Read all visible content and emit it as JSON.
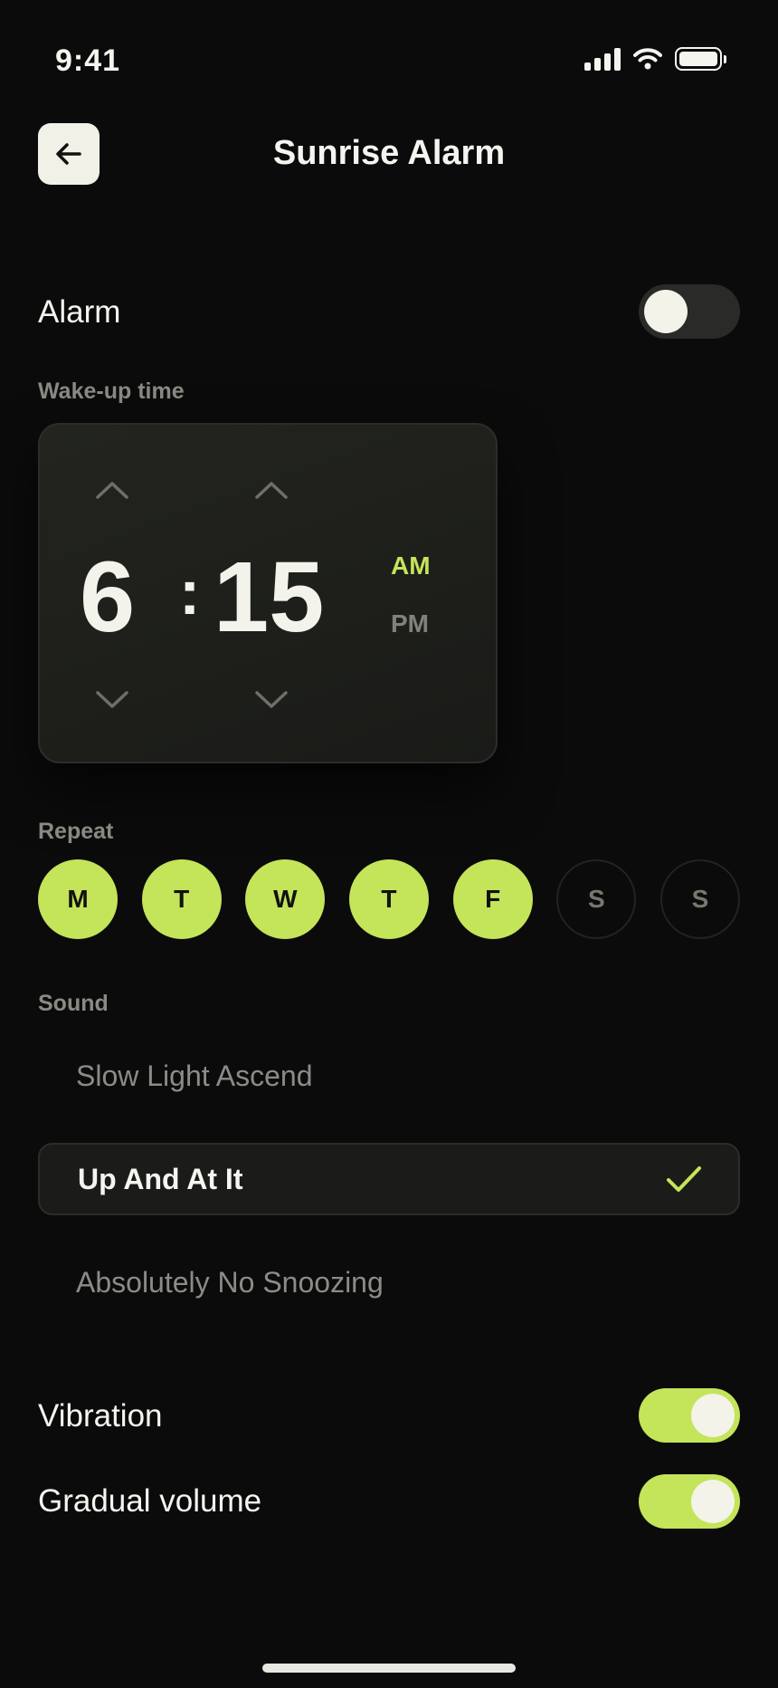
{
  "status": {
    "time": "9:41"
  },
  "header": {
    "title": "Sunrise Alarm"
  },
  "alarm": {
    "label": "Alarm",
    "enabled": false
  },
  "wake": {
    "label": "Wake-up time",
    "hour": "6",
    "separator": ":",
    "minute": "15",
    "am_label": "AM",
    "pm_label": "PM",
    "period": "AM"
  },
  "repeat": {
    "label": "Repeat",
    "days": [
      {
        "label": "M",
        "active": true
      },
      {
        "label": "T",
        "active": true
      },
      {
        "label": "W",
        "active": true
      },
      {
        "label": "T",
        "active": true
      },
      {
        "label": "F",
        "active": true
      },
      {
        "label": "S",
        "active": false
      },
      {
        "label": "S",
        "active": false
      }
    ]
  },
  "sound": {
    "label": "Sound",
    "options": [
      {
        "label": "Slow Light Ascend",
        "selected": false
      },
      {
        "label": "Up And At It",
        "selected": true
      },
      {
        "label": "Absolutely No Snoozing",
        "selected": false
      }
    ]
  },
  "vibration": {
    "label": "Vibration",
    "enabled": true
  },
  "gradual_volume": {
    "label": "Gradual volume",
    "enabled": true
  },
  "colors": {
    "accent": "#c4e45a",
    "background": "#0b0b0b"
  },
  "icons": {
    "back": "arrow-left-icon",
    "check": "checkmark-icon"
  }
}
